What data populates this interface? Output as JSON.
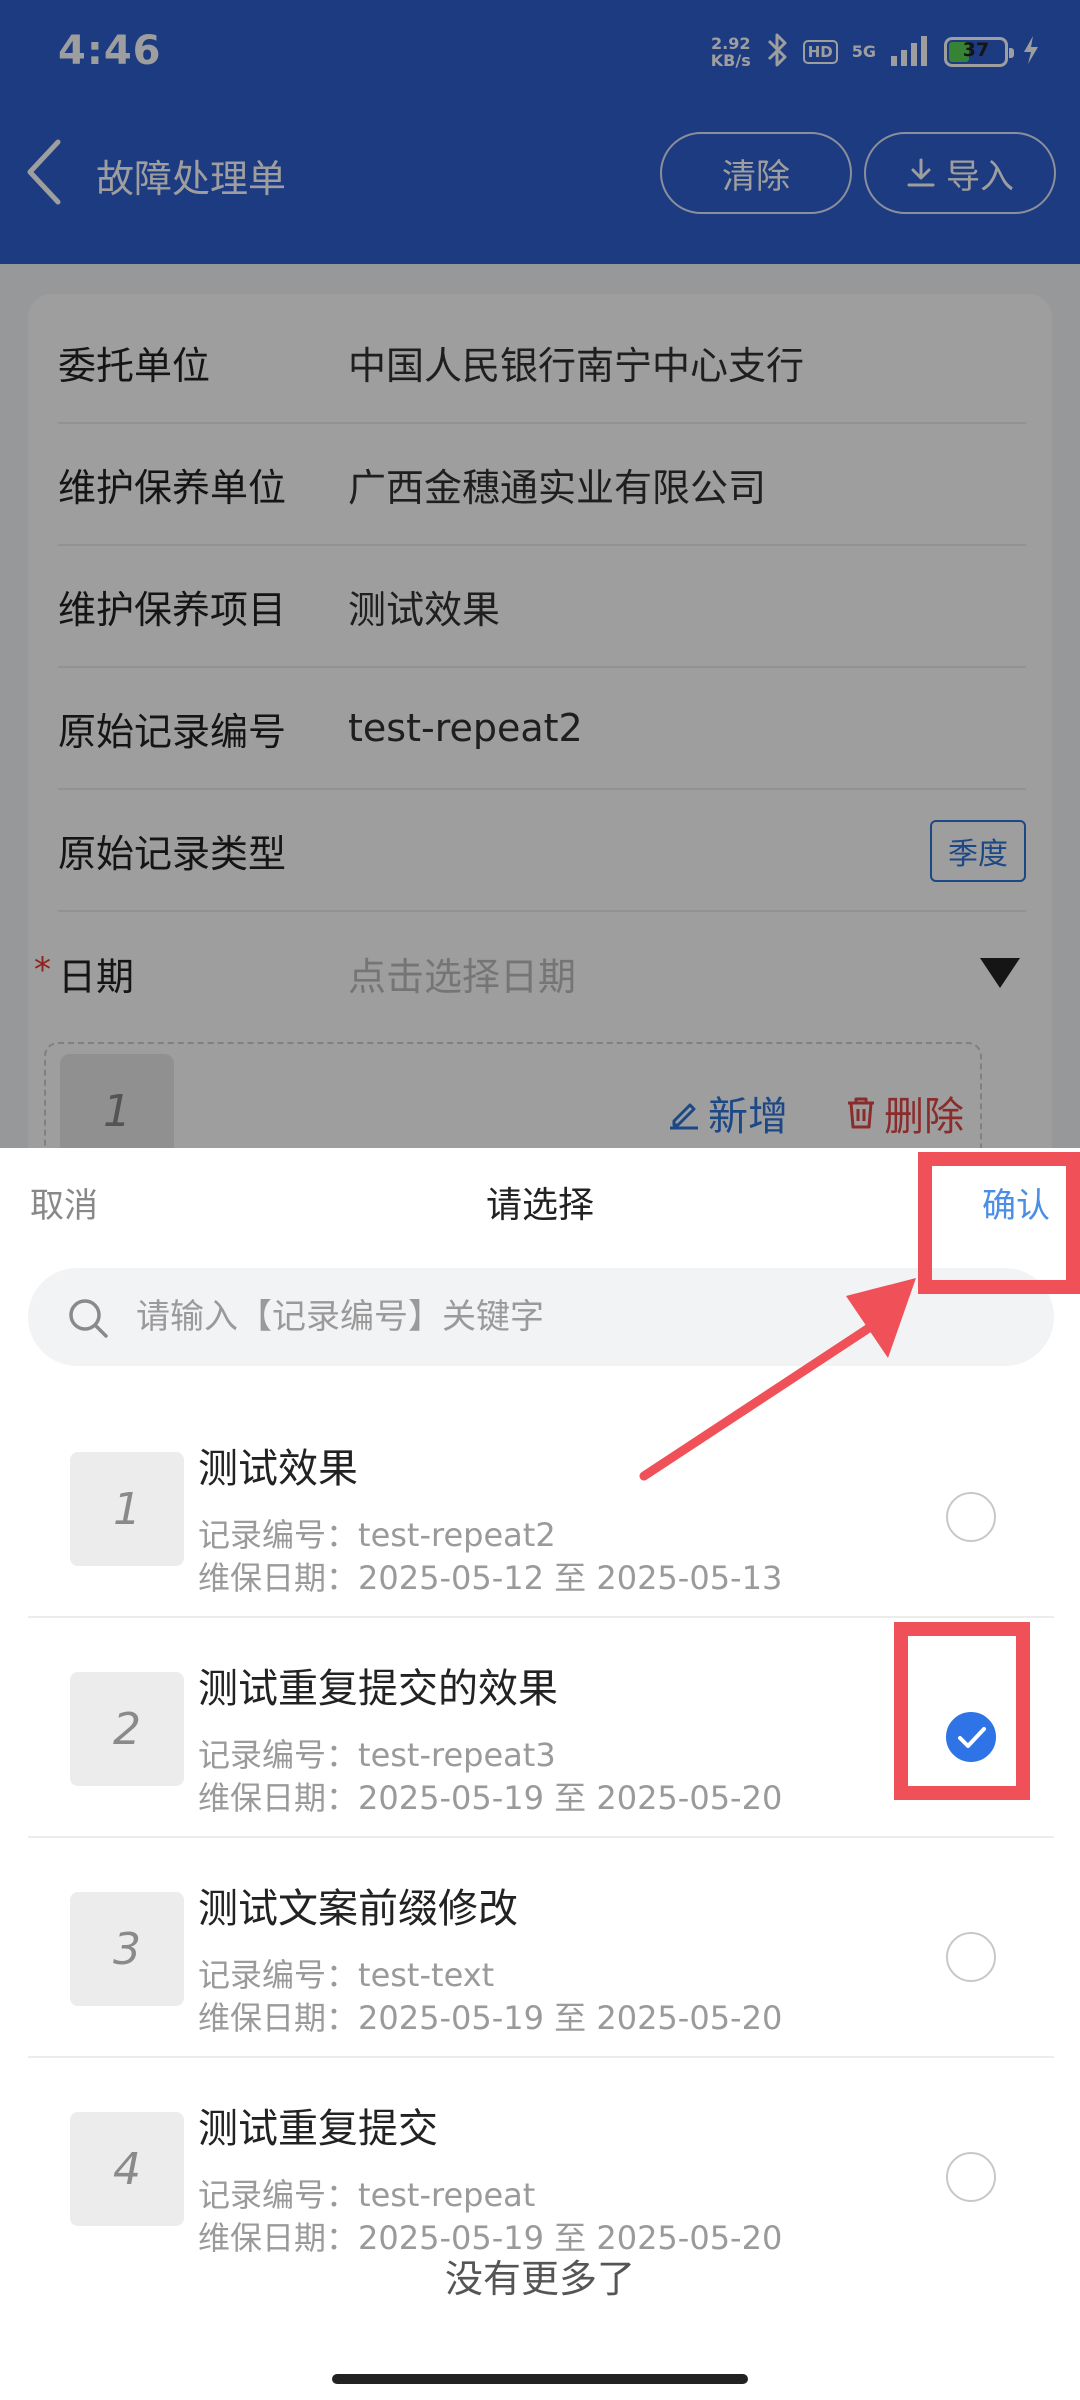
{
  "status_bar": {
    "time": "4:46",
    "net_speed_value": "2.92",
    "net_speed_unit": "KB/s",
    "hd_label": "HD",
    "signal_label": "5G",
    "battery_level": "37",
    "battery_fraction": 0.37
  },
  "nav": {
    "title": "故障处理单",
    "clear_label": "清除",
    "import_label": "导入"
  },
  "form": {
    "rows": [
      {
        "label": "委托单位",
        "value": "中国人民银行南宁中心支行"
      },
      {
        "label": "维护保养单位",
        "value": "广西金穗通实业有限公司"
      },
      {
        "label": "维护保养项目",
        "value": "测试效果"
      },
      {
        "label": "原始记录编号",
        "value": "test-repeat2"
      },
      {
        "label": "原始记录类型",
        "tag": "季度"
      },
      {
        "label": "日期",
        "placeholder": "点击选择日期",
        "required": "*"
      }
    ],
    "entry": {
      "index": "1",
      "add_label": "新增",
      "delete_label": "删除"
    }
  },
  "sheet": {
    "cancel_label": "取消",
    "title": "请选择",
    "confirm_label": "确认",
    "search_placeholder": "请输入【记录编号】关键字",
    "record_no_label": "记录编号：",
    "date_label": "维保日期：",
    "date_sep": "至",
    "items": [
      {
        "index": "1",
        "title": "测试效果",
        "record_no": "test-repeat2",
        "start": "2025-05-12",
        "end": "2025-05-13",
        "selected": false
      },
      {
        "index": "2",
        "title": "测试重复提交的效果",
        "record_no": "test-repeat3",
        "start": "2025-05-19",
        "end": "2025-05-20",
        "selected": true
      },
      {
        "index": "3",
        "title": "测试文案前缀修改",
        "record_no": "test-text",
        "start": "2025-05-19",
        "end": "2025-05-20",
        "selected": false
      },
      {
        "index": "4",
        "title": "测试重复提交",
        "record_no": "test-repeat",
        "start": "2025-05-19",
        "end": "2025-05-20",
        "selected": false
      }
    ],
    "no_more": "没有更多了"
  },
  "colors": {
    "header": "#2f5fd0",
    "accent": "#2f74e6",
    "annotation": "#f05057",
    "danger": "#e04848"
  }
}
